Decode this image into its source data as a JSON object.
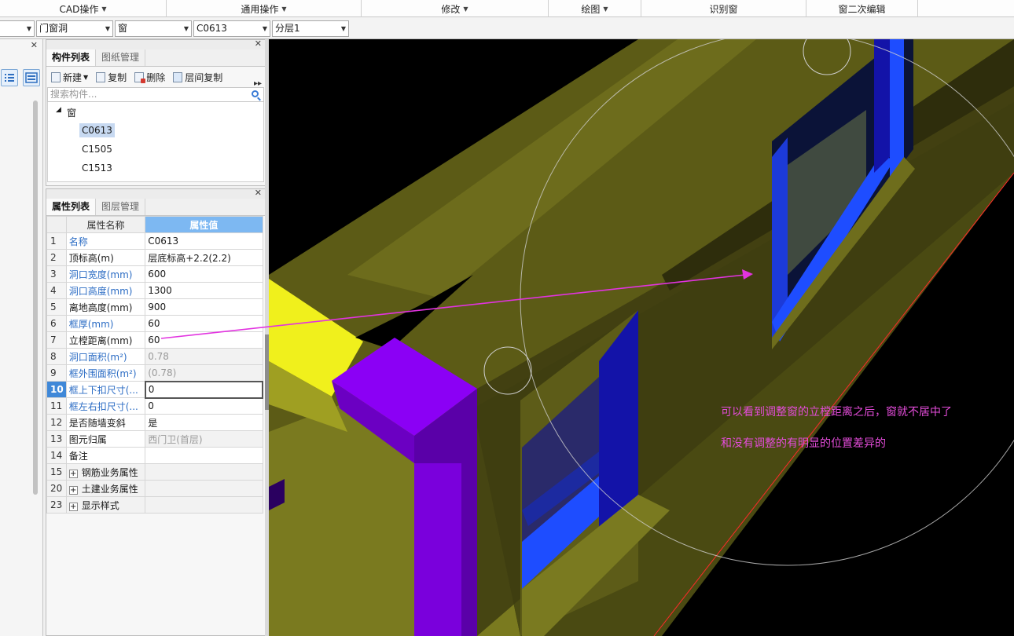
{
  "ribbon": {
    "groups": [
      {
        "label": "CAD操作",
        "has_menu": true
      },
      {
        "label": "通用操作",
        "has_menu": true
      },
      {
        "label": "修改",
        "has_menu": true
      },
      {
        "label": "绘图",
        "has_menu": true
      },
      {
        "label": "识别窗",
        "has_menu": false
      },
      {
        "label": "窗二次编辑",
        "has_menu": false
      }
    ]
  },
  "combos": {
    "first": "",
    "category": "门窗洞",
    "type": "窗",
    "component": "C0613",
    "layer": "分层1"
  },
  "component_panel": {
    "tabs": [
      "构件列表",
      "图纸管理"
    ],
    "toolbar": {
      "new": "新建",
      "copy": "复制",
      "delete": "删除",
      "floor_copy": "层间复制"
    },
    "search_placeholder": "搜索构件...",
    "tree_root": "窗",
    "items": [
      "C0613",
      "C1505",
      "C1513"
    ],
    "selected": "C0613"
  },
  "property_panel": {
    "tabs": [
      "属性列表",
      "图层管理"
    ],
    "col_name": "属性名称",
    "col_value": "属性值",
    "rows": [
      {
        "no": "1",
        "name": "名称",
        "value": "C0613",
        "style": "blue"
      },
      {
        "no": "2",
        "name": "顶标高(m)",
        "value": "层底标高+2.2(2.2)",
        "style": ""
      },
      {
        "no": "3",
        "name": "洞口宽度(mm)",
        "value": "600",
        "style": "blue"
      },
      {
        "no": "4",
        "name": "洞口高度(mm)",
        "value": "1300",
        "style": "blue"
      },
      {
        "no": "5",
        "name": "离地高度(mm)",
        "value": "900",
        "style": ""
      },
      {
        "no": "6",
        "name": "框厚(mm)",
        "value": "60",
        "style": "blue"
      },
      {
        "no": "7",
        "name": "立樘距离(mm)",
        "value": "60",
        "style": ""
      },
      {
        "no": "8",
        "name": "洞口面积(m²)",
        "value": "0.78",
        "style": "blue-grey"
      },
      {
        "no": "9",
        "name": "框外围面积(m²)",
        "value": "(0.78)",
        "style": "blue-grey"
      },
      {
        "no": "10",
        "name": "框上下扣尺寸(...",
        "value": "0",
        "style": "blue",
        "active": true
      },
      {
        "no": "11",
        "name": "框左右扣尺寸(...",
        "value": "0",
        "style": "blue"
      },
      {
        "no": "12",
        "name": "是否随墙变斜",
        "value": "是",
        "style": ""
      },
      {
        "no": "13",
        "name": "图元归属",
        "value": "西门卫(首层)",
        "style": "grey"
      },
      {
        "no": "14",
        "name": "备注",
        "value": "",
        "style": ""
      }
    ],
    "groups": [
      {
        "no": "15",
        "name": "钢筋业务属性"
      },
      {
        "no": "20",
        "name": "土建业务属性"
      },
      {
        "no": "23",
        "name": "显示样式"
      }
    ]
  },
  "annotation": {
    "line1": "可以看到调整窗的立樘距离之后，窗就不居中了",
    "line2": "和没有调整的有明显的位置差异的",
    "color": "#e34cd9"
  },
  "colors": {
    "wall_olive": "#6b6a1a",
    "wall_yellow": "#f2f21e",
    "purple": "#8a00f0",
    "window_blue": "#1e4dff",
    "selection_blue": "#c7d9f1",
    "header_blue": "#7db8f2"
  }
}
